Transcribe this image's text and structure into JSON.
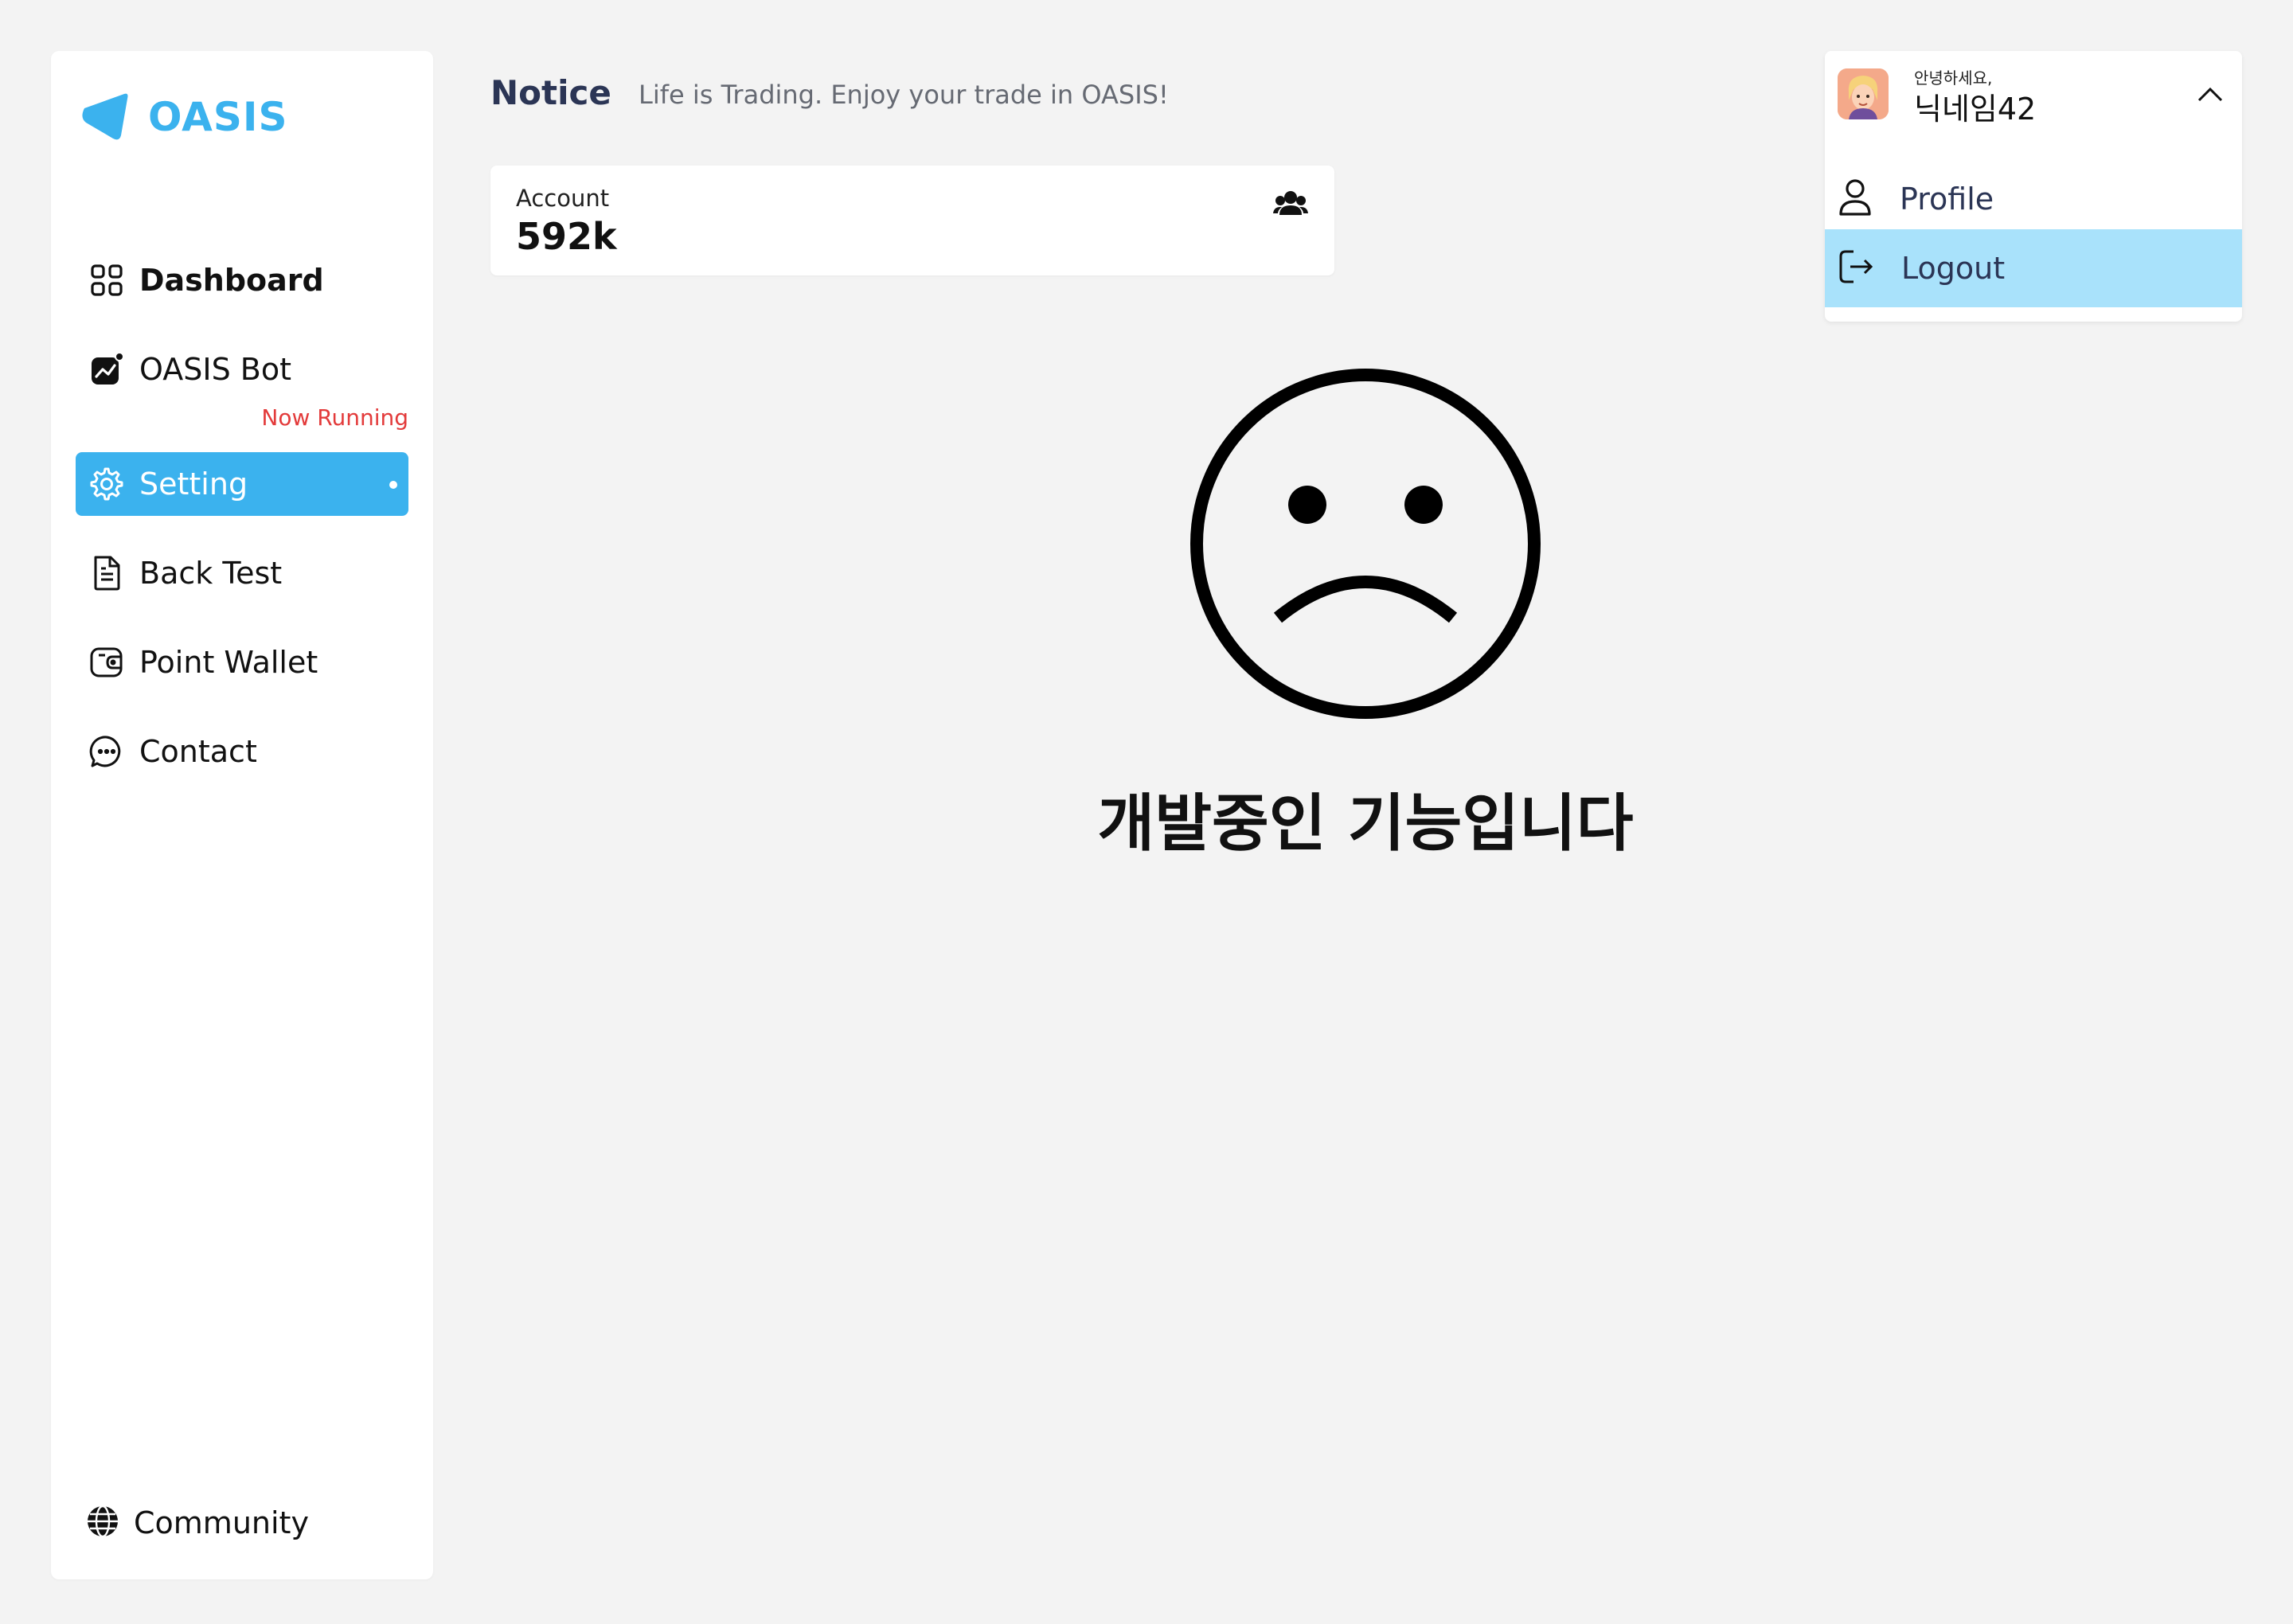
{
  "brand": {
    "name": "OASIS",
    "accent": "#3bb2ee"
  },
  "sidebar": {
    "items": [
      {
        "label": "Dashboard",
        "icon": "grid-icon"
      },
      {
        "label": "OASIS Bot",
        "icon": "chart-badge-icon",
        "status": "Now Running"
      },
      {
        "label": "Setting",
        "icon": "gear-icon",
        "active": true
      },
      {
        "label": "Back Test",
        "icon": "document-icon"
      },
      {
        "label": "Point Wallet",
        "icon": "wallet-icon"
      },
      {
        "label": "Contact",
        "icon": "chat-bubble-icon"
      }
    ],
    "community": {
      "label": "Community",
      "icon": "globe-icon"
    }
  },
  "header": {
    "notice_title": "Notice",
    "notice_text": "Life is Trading. Enjoy your trade in OASIS!"
  },
  "account": {
    "label": "Account",
    "value": "592k",
    "icon": "users-icon"
  },
  "main": {
    "message": "개발중인 기능입니다",
    "illustration": "sad-face-icon"
  },
  "user_menu": {
    "greeting": "안녕하세요,",
    "nickname": "닉네임42",
    "items": [
      {
        "label": "Profile",
        "icon": "person-icon"
      },
      {
        "label": "Logout",
        "icon": "logout-icon",
        "highlighted": true
      }
    ]
  },
  "colors": {
    "running": "#e33b3b",
    "highlight": "#a9e2fb",
    "dark_text": "#2b3555"
  }
}
